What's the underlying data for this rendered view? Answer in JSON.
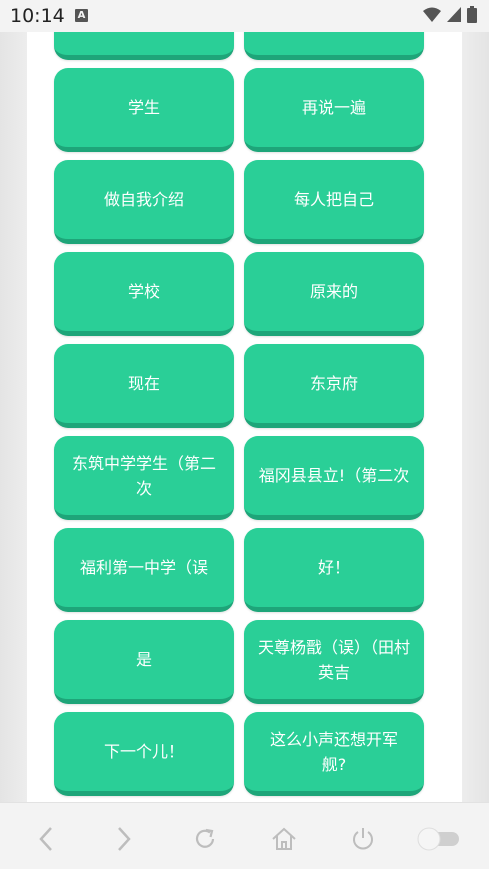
{
  "status": {
    "time": "10:14",
    "notif": "A"
  },
  "cards": [
    {
      "label": ""
    },
    {
      "label": ""
    },
    {
      "label": "学生"
    },
    {
      "label": "再说一遍"
    },
    {
      "label": "做自我介绍"
    },
    {
      "label": "每人把自己"
    },
    {
      "label": "学校"
    },
    {
      "label": "原来的"
    },
    {
      "label": "现在"
    },
    {
      "label": "东京府"
    },
    {
      "label": "东筑中学学生（第二次"
    },
    {
      "label": "福冈县县立!（第二次"
    },
    {
      "label": "福利第一中学（误"
    },
    {
      "label": "好！"
    },
    {
      "label": "是"
    },
    {
      "label": "天尊杨戬（误）（田村英吉"
    },
    {
      "label": "下一个儿！"
    },
    {
      "label": "这么小声还想开军舰?"
    }
  ],
  "colors": {
    "card": "#2acf97",
    "card_shadow": "#1ea579"
  },
  "icons": [
    "back-icon",
    "forward-icon",
    "reload-icon",
    "home-icon",
    "power-icon",
    "toggle-switch"
  ]
}
